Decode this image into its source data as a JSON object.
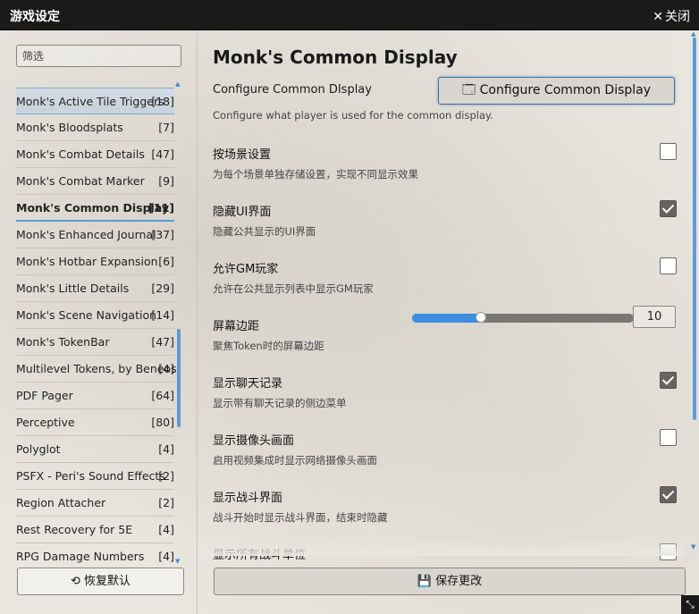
{
  "window": {
    "title": "游戏设定",
    "close_label": "关闭"
  },
  "sidebar": {
    "filter_placeholder": "筛选",
    "mods": [
      {
        "name": "Monk's Active Tile Triggers",
        "count": "[18]"
      },
      {
        "name": "Monk's Bloodsplats",
        "count": "[7]"
      },
      {
        "name": "Monk's Combat Details",
        "count": "[47]"
      },
      {
        "name": "Monk's Combat Marker",
        "count": "[9]"
      },
      {
        "name": "Monk's Common Display",
        "count": "[11]"
      },
      {
        "name": "Monk's Enhanced Journal",
        "count": "[37]"
      },
      {
        "name": "Monk's Hotbar Expansion",
        "count": "[6]"
      },
      {
        "name": "Monk's Little Details",
        "count": "[29]"
      },
      {
        "name": "Monk's Scene Navigation",
        "count": "[14]"
      },
      {
        "name": "Monk's TokenBar",
        "count": "[47]"
      },
      {
        "name": "Multilevel Tokens, by Beneos",
        "count": "[4]"
      },
      {
        "name": "PDF Pager",
        "count": "[64]"
      },
      {
        "name": "Perceptive",
        "count": "[80]"
      },
      {
        "name": "Polyglot",
        "count": "[4]"
      },
      {
        "name": "PSFX - Peri's Sound Effects",
        "count": "[2]"
      },
      {
        "name": "Region Attacher",
        "count": "[2]"
      },
      {
        "name": "Rest Recovery for 5E",
        "count": "[4]"
      },
      {
        "name": "RPG Damage Numbers",
        "count": "[4]"
      }
    ],
    "reset_label": "恢复默认"
  },
  "main": {
    "module_title": "Monk's Common Display",
    "configure_label": "Configure Common DIsplay",
    "configure_button": "Configure Common Display",
    "configure_hint": "Configure what player is used for the common display.",
    "settings": [
      {
        "label": "按场景设置",
        "hint": "为每个场景单独存储设置，实现不同显示效果",
        "checked": false
      },
      {
        "label": "隐藏UI界面",
        "hint": "隐藏公共显示的UI界面",
        "checked": true
      },
      {
        "label": "允许GM玩家",
        "hint": "允许在公共显示列表中显示GM玩家",
        "checked": false
      },
      {
        "label": "屏幕边距",
        "hint": "聚焦Token时的屏幕边距",
        "slider_fraction": 0.31,
        "value": "10"
      },
      {
        "label": "显示聊天记录",
        "hint": "显示带有聊天记录的侧边菜单",
        "checked": true
      },
      {
        "label": "显示摄像头画面",
        "hint": "启用视频集成时显示网络摄像头画面",
        "checked": false
      },
      {
        "label": "显示战斗界面",
        "hint": "战斗开始时显示战斗界面，结束时隐藏",
        "checked": true
      },
      {
        "label": "显示所有战斗单位",
        "hint": "",
        "checked": false
      }
    ],
    "save_label": "保存更改"
  }
}
